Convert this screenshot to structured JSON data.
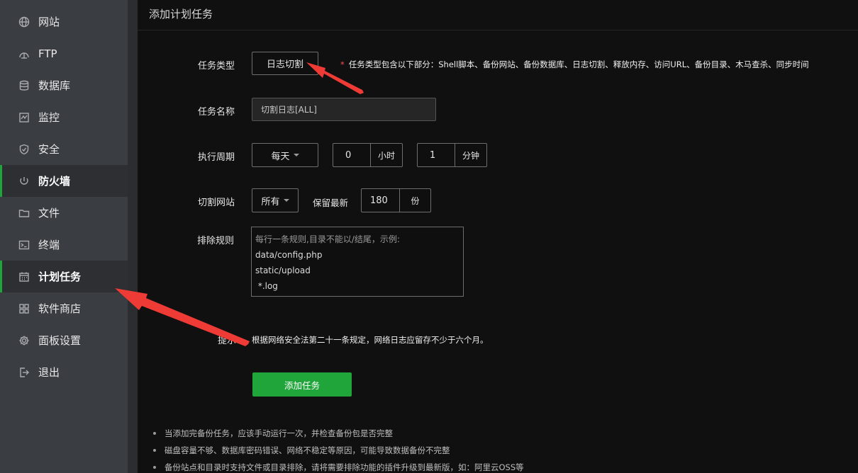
{
  "sidebar": {
    "items": [
      {
        "label": "网站",
        "icon": "globe-icon"
      },
      {
        "label": "FTP",
        "icon": "ftp-icon"
      },
      {
        "label": "数据库",
        "icon": "database-icon"
      },
      {
        "label": "监控",
        "icon": "monitor-icon"
      },
      {
        "label": "安全",
        "icon": "shield-icon"
      },
      {
        "label": "防火墙",
        "icon": "firewall-icon"
      },
      {
        "label": "文件",
        "icon": "folder-icon"
      },
      {
        "label": "终端",
        "icon": "terminal-icon"
      },
      {
        "label": "计划任务",
        "icon": "calendar-icon"
      },
      {
        "label": "软件商店",
        "icon": "apps-grid-icon"
      },
      {
        "label": "面板设置",
        "icon": "gear-icon"
      },
      {
        "label": "退出",
        "icon": "logout-icon"
      }
    ]
  },
  "form": {
    "title": "添加计划任务",
    "task_type_label": "任务类型",
    "task_type_value": "日志切割",
    "task_type_note": "任务类型包含以下部分：Shell脚本、备份网站、备份数据库、日志切割、释放内存、访问URL、备份目录、木马查杀、同步时间",
    "task_name_label": "任务名称",
    "task_name_value": "切割日志[ALL]",
    "period_label": "执行周期",
    "period_value": "每天",
    "hour_value": "0",
    "hour_unit": "小时",
    "minute_value": "1",
    "minute_unit": "分钟",
    "site_label": "切割网站",
    "site_value": "所有",
    "keep_label": "保留最新",
    "keep_value": "180",
    "keep_unit": "份",
    "exclude_label": "排除规则",
    "exclude_placeholder": "每行一条规则,目录不能以/结尾，示例:",
    "exclude_lines": [
      "data/config.php",
      "static/upload",
      " *.log"
    ],
    "hint_label": "提示",
    "hint_text": "根据网络安全法第二十一条规定，网络日志应留存不少于六个月。",
    "submit_label": "添加任务"
  },
  "tips": [
    "当添加完备份任务，应该手动运行一次，并检查备份包是否完整",
    "磁盘容量不够、数据库密码错误、网络不稳定等原因，可能导致数据备份不完整",
    "备份站点和目录时支持文件或目录排除，请将需要排除功能的插件升级到最新版，如：阿里云OSS等"
  ],
  "colors": {
    "accent_green": "#20a53a",
    "annotation_red": "#ee3b35",
    "required_star": "#ff4d4f"
  }
}
